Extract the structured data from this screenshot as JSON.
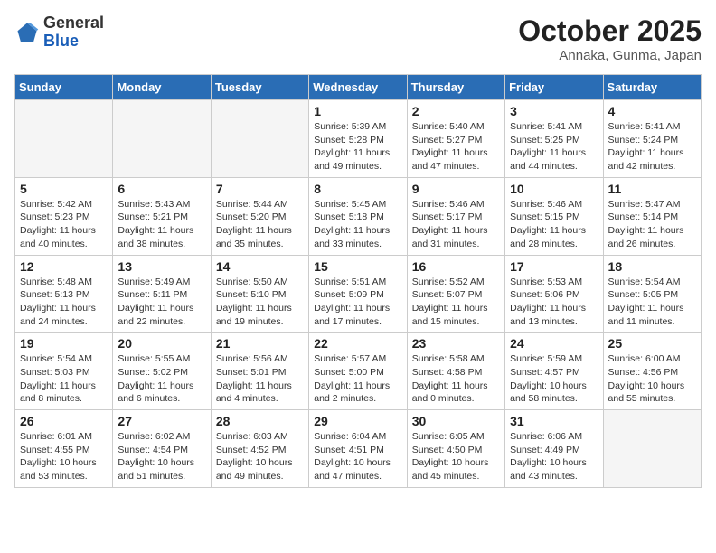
{
  "logo": {
    "line1": "General",
    "line2": "Blue"
  },
  "header": {
    "month": "October 2025",
    "location": "Annaka, Gunma, Japan"
  },
  "weekdays": [
    "Sunday",
    "Monday",
    "Tuesday",
    "Wednesday",
    "Thursday",
    "Friday",
    "Saturday"
  ],
  "weeks": [
    [
      {
        "day": "",
        "text": ""
      },
      {
        "day": "",
        "text": ""
      },
      {
        "day": "",
        "text": ""
      },
      {
        "day": "1",
        "text": "Sunrise: 5:39 AM\nSunset: 5:28 PM\nDaylight: 11 hours\nand 49 minutes."
      },
      {
        "day": "2",
        "text": "Sunrise: 5:40 AM\nSunset: 5:27 PM\nDaylight: 11 hours\nand 47 minutes."
      },
      {
        "day": "3",
        "text": "Sunrise: 5:41 AM\nSunset: 5:25 PM\nDaylight: 11 hours\nand 44 minutes."
      },
      {
        "day": "4",
        "text": "Sunrise: 5:41 AM\nSunset: 5:24 PM\nDaylight: 11 hours\nand 42 minutes."
      }
    ],
    [
      {
        "day": "5",
        "text": "Sunrise: 5:42 AM\nSunset: 5:23 PM\nDaylight: 11 hours\nand 40 minutes."
      },
      {
        "day": "6",
        "text": "Sunrise: 5:43 AM\nSunset: 5:21 PM\nDaylight: 11 hours\nand 38 minutes."
      },
      {
        "day": "7",
        "text": "Sunrise: 5:44 AM\nSunset: 5:20 PM\nDaylight: 11 hours\nand 35 minutes."
      },
      {
        "day": "8",
        "text": "Sunrise: 5:45 AM\nSunset: 5:18 PM\nDaylight: 11 hours\nand 33 minutes."
      },
      {
        "day": "9",
        "text": "Sunrise: 5:46 AM\nSunset: 5:17 PM\nDaylight: 11 hours\nand 31 minutes."
      },
      {
        "day": "10",
        "text": "Sunrise: 5:46 AM\nSunset: 5:15 PM\nDaylight: 11 hours\nand 28 minutes."
      },
      {
        "day": "11",
        "text": "Sunrise: 5:47 AM\nSunset: 5:14 PM\nDaylight: 11 hours\nand 26 minutes."
      }
    ],
    [
      {
        "day": "12",
        "text": "Sunrise: 5:48 AM\nSunset: 5:13 PM\nDaylight: 11 hours\nand 24 minutes."
      },
      {
        "day": "13",
        "text": "Sunrise: 5:49 AM\nSunset: 5:11 PM\nDaylight: 11 hours\nand 22 minutes."
      },
      {
        "day": "14",
        "text": "Sunrise: 5:50 AM\nSunset: 5:10 PM\nDaylight: 11 hours\nand 19 minutes."
      },
      {
        "day": "15",
        "text": "Sunrise: 5:51 AM\nSunset: 5:09 PM\nDaylight: 11 hours\nand 17 minutes."
      },
      {
        "day": "16",
        "text": "Sunrise: 5:52 AM\nSunset: 5:07 PM\nDaylight: 11 hours\nand 15 minutes."
      },
      {
        "day": "17",
        "text": "Sunrise: 5:53 AM\nSunset: 5:06 PM\nDaylight: 11 hours\nand 13 minutes."
      },
      {
        "day": "18",
        "text": "Sunrise: 5:54 AM\nSunset: 5:05 PM\nDaylight: 11 hours\nand 11 minutes."
      }
    ],
    [
      {
        "day": "19",
        "text": "Sunrise: 5:54 AM\nSunset: 5:03 PM\nDaylight: 11 hours\nand 8 minutes."
      },
      {
        "day": "20",
        "text": "Sunrise: 5:55 AM\nSunset: 5:02 PM\nDaylight: 11 hours\nand 6 minutes."
      },
      {
        "day": "21",
        "text": "Sunrise: 5:56 AM\nSunset: 5:01 PM\nDaylight: 11 hours\nand 4 minutes."
      },
      {
        "day": "22",
        "text": "Sunrise: 5:57 AM\nSunset: 5:00 PM\nDaylight: 11 hours\nand 2 minutes."
      },
      {
        "day": "23",
        "text": "Sunrise: 5:58 AM\nSunset: 4:58 PM\nDaylight: 11 hours\nand 0 minutes."
      },
      {
        "day": "24",
        "text": "Sunrise: 5:59 AM\nSunset: 4:57 PM\nDaylight: 10 hours\nand 58 minutes."
      },
      {
        "day": "25",
        "text": "Sunrise: 6:00 AM\nSunset: 4:56 PM\nDaylight: 10 hours\nand 55 minutes."
      }
    ],
    [
      {
        "day": "26",
        "text": "Sunrise: 6:01 AM\nSunset: 4:55 PM\nDaylight: 10 hours\nand 53 minutes."
      },
      {
        "day": "27",
        "text": "Sunrise: 6:02 AM\nSunset: 4:54 PM\nDaylight: 10 hours\nand 51 minutes."
      },
      {
        "day": "28",
        "text": "Sunrise: 6:03 AM\nSunset: 4:52 PM\nDaylight: 10 hours\nand 49 minutes."
      },
      {
        "day": "29",
        "text": "Sunrise: 6:04 AM\nSunset: 4:51 PM\nDaylight: 10 hours\nand 47 minutes."
      },
      {
        "day": "30",
        "text": "Sunrise: 6:05 AM\nSunset: 4:50 PM\nDaylight: 10 hours\nand 45 minutes."
      },
      {
        "day": "31",
        "text": "Sunrise: 6:06 AM\nSunset: 4:49 PM\nDaylight: 10 hours\nand 43 minutes."
      },
      {
        "day": "",
        "text": ""
      }
    ]
  ]
}
